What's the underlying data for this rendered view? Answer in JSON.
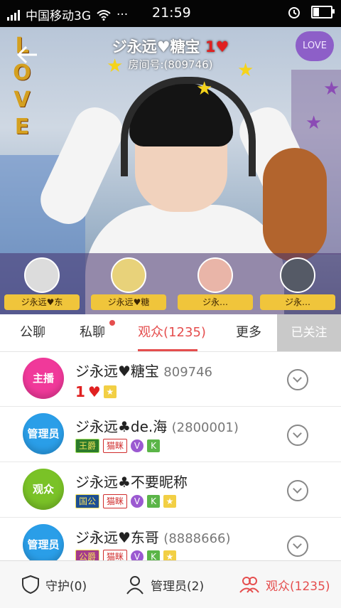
{
  "status_bar": {
    "carrier": "中国移动3G",
    "time": "21:59",
    "dots": "···"
  },
  "room": {
    "title": "ジ永远♥糖宝",
    "heart_count": "1",
    "room_no": "房间号:(809746)"
  },
  "overlay_text": {
    "love_left": "LOVE",
    "love_right": "LOVE"
  },
  "top_avatars": [
    {
      "label": "ジ永远♥东"
    },
    {
      "label": "ジ永远♥糖"
    },
    {
      "label": "ジ永…"
    },
    {
      "label": "ジ永…"
    }
  ],
  "tabs": {
    "items": [
      "公聊",
      "私聊",
      "观众(1235)",
      "更多"
    ],
    "active_index": 2,
    "follow_label": "已关注"
  },
  "list": [
    {
      "role": "主播",
      "name": "ジ永远♥糖宝",
      "uid": "809746",
      "hearts": "1"
    },
    {
      "role": "管理员",
      "name": "ジ永远♣de.海",
      "uid": "(2800001)",
      "tag1": "王爵",
      "tag2": "猫眯",
      "v": "V",
      "k": "K"
    },
    {
      "role": "观众",
      "name": "ジ永远♣不要昵称",
      "uid": "",
      "tag1": "国公",
      "tag2": "猫眯",
      "v": "V",
      "k": "K"
    },
    {
      "role": "管理员",
      "name": "ジ永远♥东哥",
      "uid": "(8888666)",
      "tag1": "公爵",
      "tag2": "猫眯",
      "v": "V",
      "k": "K"
    }
  ],
  "bottom_bar": {
    "guard": "守护(0)",
    "admins": "管理员(2)",
    "viewers": "观众(1235)"
  },
  "colors": {
    "accent": "#e54e4e",
    "host": "#f0399a",
    "admin": "#2a9ee8",
    "viewer": "#7ac227"
  }
}
